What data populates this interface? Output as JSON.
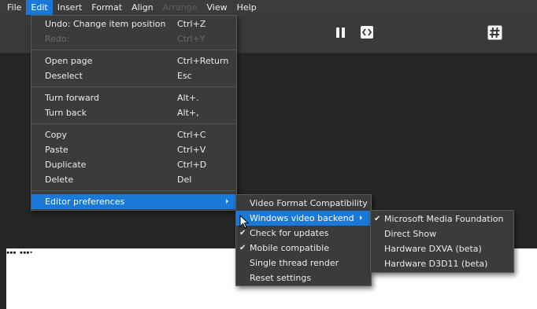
{
  "menubar": {
    "items": [
      {
        "label": "File"
      },
      {
        "label": "Edit"
      },
      {
        "label": "Insert"
      },
      {
        "label": "Format"
      },
      {
        "label": "Align"
      },
      {
        "label": "Arrange"
      },
      {
        "label": "View"
      },
      {
        "label": "Help"
      }
    ]
  },
  "toolbar": {
    "icons": [
      "pause-icon",
      "code-icon",
      "hash-icon"
    ]
  },
  "edit_menu": {
    "items": [
      {
        "label": "Undo:  Change item position",
        "shortcut": "Ctrl+Z"
      },
      {
        "label": "Redo:",
        "shortcut": "Ctrl+Y"
      },
      {
        "label": "Open page",
        "shortcut": "Ctrl+Return"
      },
      {
        "label": "Deselect",
        "shortcut": "Esc"
      },
      {
        "label": "Turn forward",
        "shortcut": "Alt+."
      },
      {
        "label": "Turn back",
        "shortcut": "Alt+,"
      },
      {
        "label": "Copy",
        "shortcut": "Ctrl+C"
      },
      {
        "label": "Paste",
        "shortcut": "Ctrl+V"
      },
      {
        "label": "Duplicate",
        "shortcut": "Ctrl+D"
      },
      {
        "label": "Delete",
        "shortcut": "Del"
      },
      {
        "label": "Editor preferences"
      }
    ]
  },
  "prefs_menu": {
    "items": [
      {
        "label": "Video Format Compatibility"
      },
      {
        "label": "Windows video backend"
      },
      {
        "label": "Check for updates"
      },
      {
        "label": "Mobile compatible"
      },
      {
        "label": "Single thread render"
      },
      {
        "label": "Reset settings"
      }
    ]
  },
  "backend_menu": {
    "items": [
      {
        "label": "Microsoft Media Foundation"
      },
      {
        "label": "Direct Show"
      },
      {
        "label": "Hardware DXVA (beta)"
      },
      {
        "label": "Hardware D3D11 (beta)"
      }
    ]
  },
  "canvas": {
    "handle_text": "▪▪▪ ▪▪▪▾"
  },
  "colors": {
    "menubar_bg": "#3c3c3c",
    "toolbar_bg": "#3a3a3a",
    "workarea_bg": "#262626",
    "menu_bg": "#3b3b3b",
    "highlight": "#1a79d8",
    "text": "#ececec",
    "disabled_text": "#6a6a6a"
  }
}
